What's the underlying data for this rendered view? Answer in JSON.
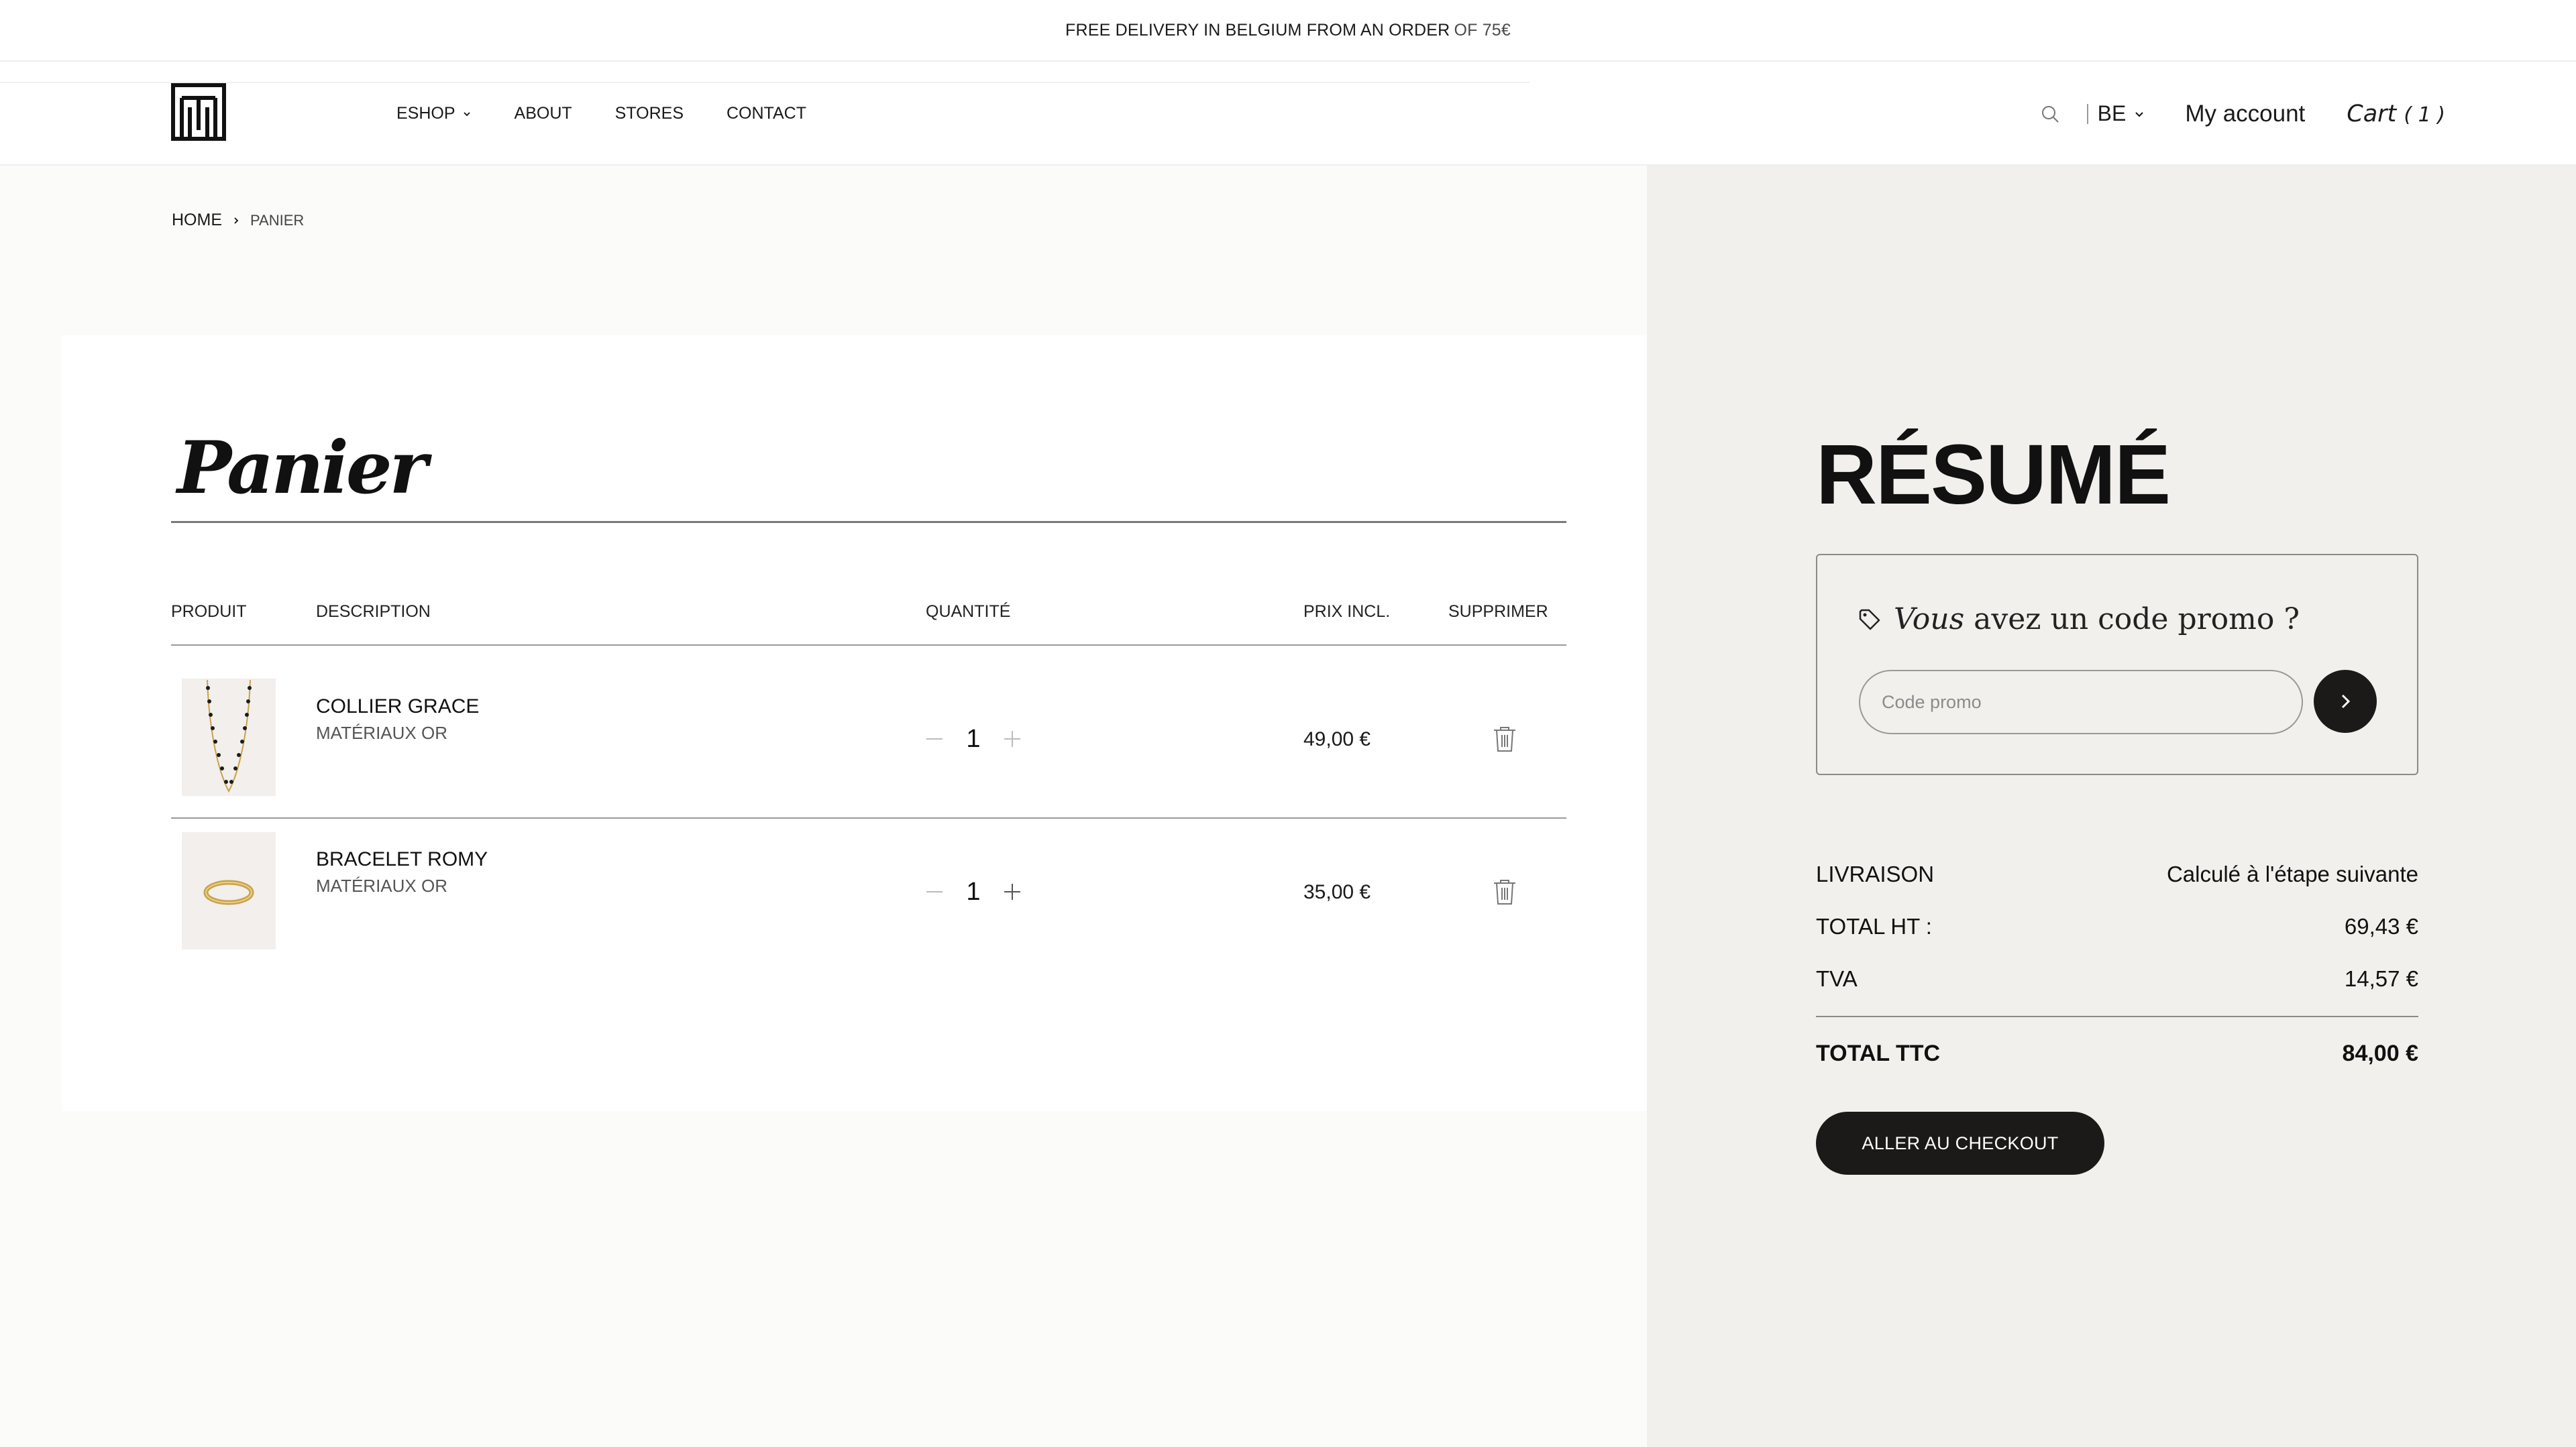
{
  "announcement": {
    "main": "FREE DELIVERY IN BELGIUM FROM AN ORDER",
    "accent": "OF 75€"
  },
  "header": {
    "logo": "brand-monogram-logo",
    "nav": [
      {
        "label": "ESHOP",
        "has_dropdown": true
      },
      {
        "label": "ABOUT"
      },
      {
        "label": "STORES"
      },
      {
        "label": "CONTACT"
      }
    ],
    "language": "BE",
    "account_label": "My account",
    "cart_label": "Cart",
    "cart_count": "( 1 )"
  },
  "breadcrumb": {
    "home": "HOME",
    "current": "PANIER"
  },
  "cart": {
    "title": "Panier",
    "columns": {
      "product": "PRODUIT",
      "description": "DESCRIPTION",
      "quantity": "QUANTITÉ",
      "price": "PRIX INCL.",
      "delete": "SUPPRIMER"
    },
    "items": [
      {
        "name": "COLLIER GRACE",
        "material": "MATÉRIAUX OR",
        "quantity": "1",
        "price": "49,00 €",
        "image": "necklace-image"
      },
      {
        "name": "BRACELET ROMY",
        "material": "MATÉRIAUX OR",
        "quantity": "1",
        "price": "35,00 €",
        "image": "bracelet-image"
      }
    ]
  },
  "summary": {
    "title": "RÉSUMÉ",
    "promo_heading_italic": "Vous",
    "promo_heading_rest": "avez un code promo ?",
    "promo_placeholder": "Code promo",
    "rows": [
      {
        "label": "LIVRAISON",
        "value": "Calculé à l'étape suivante"
      },
      {
        "label": "TOTAL HT :",
        "value": "69,43 €"
      },
      {
        "label": "TVA",
        "value": "14,57 €"
      }
    ],
    "total": {
      "label": "TOTAL TTC",
      "value": "84,00 €"
    },
    "checkout_label": "ALLER AU CHECKOUT"
  },
  "colors": {
    "dark": "#1b1a18",
    "summary_bg": "#f1f0ed",
    "thumb_bg": "#f2efec",
    "page_bg": "#fbfbfa",
    "gold": "#c9a24a"
  }
}
